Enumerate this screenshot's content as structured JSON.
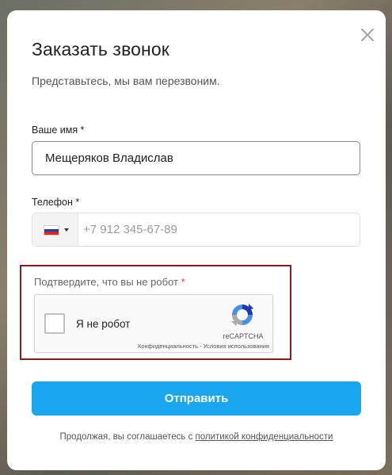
{
  "modal": {
    "title": "Заказать звонок",
    "subtitle": "Представьтесь, мы вам перезвоним."
  },
  "name_field": {
    "label": "Ваше имя *",
    "value": "Мещеряков Владислав"
  },
  "phone_field": {
    "label": "Телефон *",
    "placeholder": "+7 912 345-67-89",
    "country_flag": "russia-flag-icon"
  },
  "captcha": {
    "label": "Подтвердите, что вы не робот",
    "required_mark": "*",
    "checkbox_label": "Я не робот",
    "brand": "reCAPTCHA",
    "privacy_link": "Конфиденциальность",
    "separator": "-",
    "terms_link": "Условия использования"
  },
  "submit_label": "Отправить",
  "footer": {
    "text": "Продолжая, вы соглашаетесь с ",
    "link": "политикой конфиденциальности"
  },
  "colors": {
    "accent": "#1aa7f0",
    "captcha_border": "#8b1a1a",
    "required": "#e53935"
  }
}
